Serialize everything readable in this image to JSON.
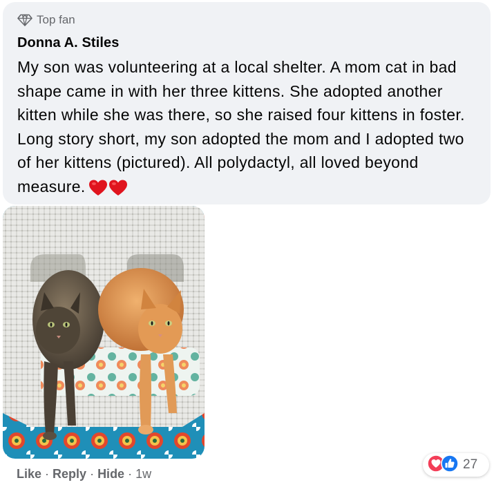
{
  "comment": {
    "badge_label": "Top fan",
    "badge_icon": "diamond-icon",
    "author": "Donna A. Stiles",
    "text": "My son was volunteering at a local shelter. A mom cat in bad shape came in with her three kittens. She adopted another kitten while she was there, so she raised four kittens in foster. Long story short, my son adopted the mom and I adopted two of her kittens (pictured). All polydactyl, all loved beyond measure.",
    "emoji": "heart-heart",
    "bubble_color": "#f0f2f5"
  },
  "actions": {
    "like_label": "Like",
    "reply_label": "Reply",
    "hide_label": "Hide",
    "separator": "·",
    "timestamp": "1w",
    "text_color": "#65676b"
  },
  "reactions": {
    "icons": [
      "love-reaction-icon",
      "like-reaction-icon"
    ],
    "count": "27",
    "love_color": "#f33e58",
    "like_color": "#1877f2"
  }
}
